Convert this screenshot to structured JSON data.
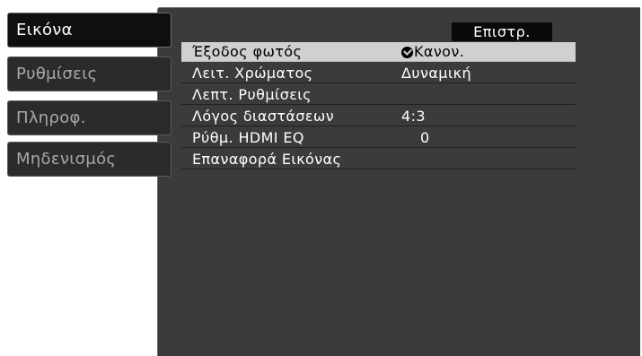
{
  "sidebar": {
    "items": [
      {
        "label": "Εικόνα"
      },
      {
        "label": "Ρυθμίσεις"
      },
      {
        "label": "Πληροφ."
      },
      {
        "label": "Μηδενισμός"
      }
    ]
  },
  "panel": {
    "back_label": "Επιστρ.",
    "rows": [
      {
        "label": "Έξοδος φωτός",
        "value": "Κανον.",
        "icon": "check-circle-icon"
      },
      {
        "label": "Λειτ. Χρώματος",
        "value": "Δυναμική"
      },
      {
        "label": "Λεπτ. Ρυθμίσεις",
        "value": ""
      },
      {
        "label": "Λόγος διαστάσεων",
        "value": "4:3"
      },
      {
        "label": "Ρύθμ. HDMI EQ",
        "value": "0"
      },
      {
        "label": "Επαναφορά Εικόνας",
        "value": ""
      }
    ]
  },
  "colors": {
    "panel_bg": "#3b3b3b",
    "active_tab_bg": "#0f0f0f",
    "selected_row_bg": "#d0d0d0"
  }
}
